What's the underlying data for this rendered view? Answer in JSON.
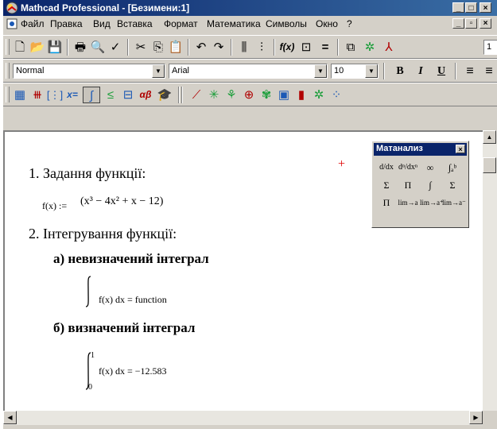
{
  "window": {
    "title": "Mathcad Professional - [Безимени:1]"
  },
  "caption_buttons": {
    "minimize": "_",
    "maximize": "□",
    "close": "×"
  },
  "menu": {
    "items": [
      "Файл",
      "Правка",
      "Вид",
      "Вставка",
      "Формат",
      "Математика",
      "Символы",
      "Окно",
      "?"
    ],
    "mdi_minimize": "_",
    "mdi_restore": "▫",
    "mdi_close": "×"
  },
  "toolbar_standard": {
    "overflow_label": "1"
  },
  "formatting": {
    "style": "Normal",
    "font": "Arial",
    "size": "10",
    "bold": "B",
    "italic": "I",
    "underline": "U",
    "align": "≡"
  },
  "math_toolbar": {
    "evaluation": "x=",
    "greek": "αβ"
  },
  "document": {
    "heading1": "1. Задання функції:",
    "func_lhs": "f(x) := ",
    "func_body": "(x³ − 4x² + x − 12)",
    "heading2": "2. Інтегрування функції:",
    "sub_a": "а) невизначений інтеграл",
    "integral_indef": "f(x) dx = function",
    "sub_b": "б) визначений інтеграл",
    "integral_def": "f(x) dx = −12.583",
    "upper_limit": "1",
    "lower_limit": "0",
    "crosshair": "+"
  },
  "palette": {
    "title": "Матанализ",
    "close": "×",
    "buttons": [
      "d/dx",
      "dⁿ/dxⁿ",
      "∞",
      "∫ₐᵇ",
      "Σ",
      "Π",
      "∫",
      "Σ",
      "Π",
      "lim→a",
      "lim→a⁺",
      "lim→a⁻"
    ]
  },
  "colors": {
    "title_start": "#0a246a",
    "title_end": "#3a6ea5",
    "chrome": "#d4d0c8",
    "crosshair": "#e00000"
  }
}
